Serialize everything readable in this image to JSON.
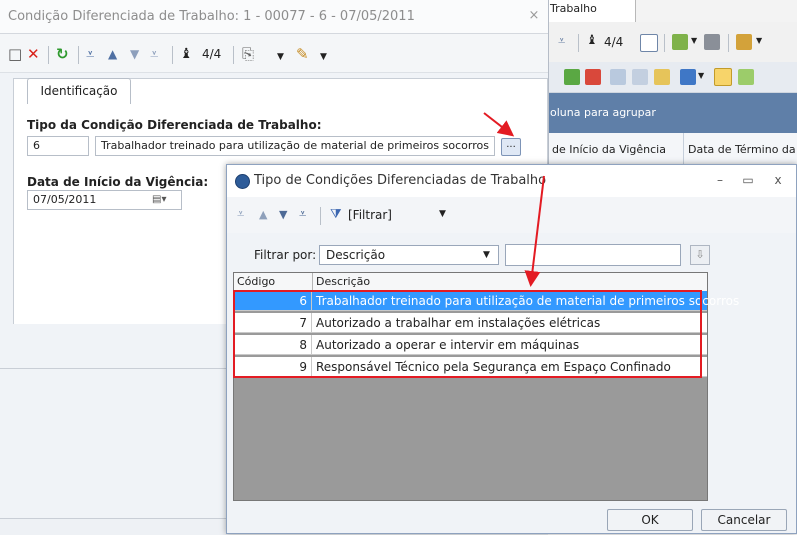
{
  "colors": {
    "accent_red": "#e31b23",
    "selection": "#3399ff",
    "group_bar": "#5f7fa8"
  },
  "background_window": {
    "tab_label": "Trabalho",
    "toolbar": {
      "record_counter": "4/4"
    },
    "group_panel_text": "oluna para agrupar",
    "columns": [
      "de Início da Vigência",
      "Data de Término da"
    ]
  },
  "main_window": {
    "title": "Condição Diferenciada de Trabalho: 1 - 00077 - 6 - 07/05/2011",
    "close_glyph": "×",
    "toolbar": {
      "record_counter": "4/4"
    },
    "tab": "Identificação",
    "tipo": {
      "label": "Tipo da Condição Diferenciada de Trabalho:",
      "code": "6",
      "description": "Trabalhador treinado para utilização de material de primeiros socorros",
      "lookup_button": "..."
    },
    "data_inicio": {
      "label": "Data de Início da Vigência:",
      "value": "07/05/2011"
    }
  },
  "dialog": {
    "title": "Tipo de Condições Diferenciadas de Trabalho",
    "controls": {
      "minimize": "–",
      "maximize": "▭",
      "close": "x"
    },
    "toolbar": {
      "filter_button": "[Filtrar]"
    },
    "filter": {
      "label": "Filtrar por:",
      "selected": "Descrição",
      "value": ""
    },
    "grid": {
      "columns": [
        "Código",
        "Descrição"
      ],
      "rows": [
        {
          "code": "6",
          "description": "Trabalhador treinado para utilização de material de primeiros socorros"
        },
        {
          "code": "7",
          "description": "Autorizado a trabalhar em instalações elétricas"
        },
        {
          "code": "8",
          "description": "Autorizado a operar e intervir em máquinas"
        },
        {
          "code": "9",
          "description": "Responsável Técnico pela Segurança em Espaço Confinado"
        }
      ],
      "selected_index": 0
    },
    "buttons": {
      "ok": "OK",
      "cancel": "Cancelar"
    }
  }
}
